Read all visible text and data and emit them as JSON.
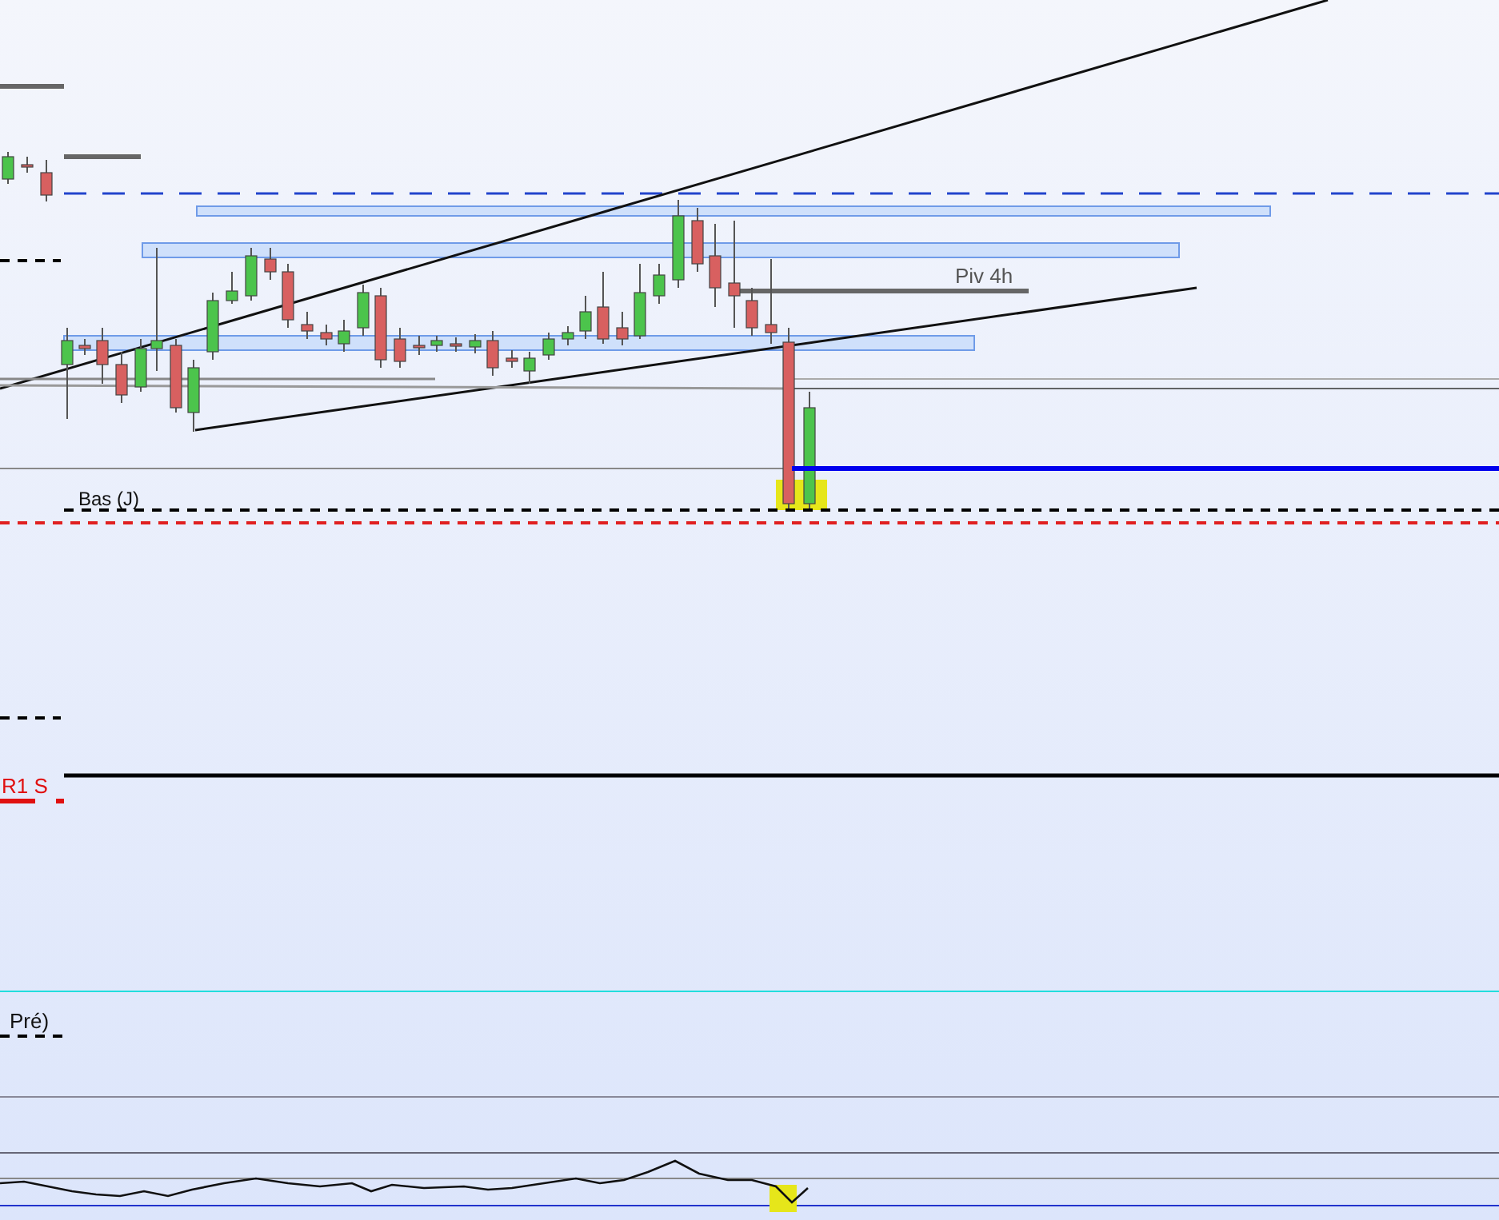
{
  "chart": {
    "pivot_label": "Piv 4h",
    "low_label": "Bas (J)",
    "resistance_label": "R1 S",
    "indicator_label": "Pré)"
  }
}
